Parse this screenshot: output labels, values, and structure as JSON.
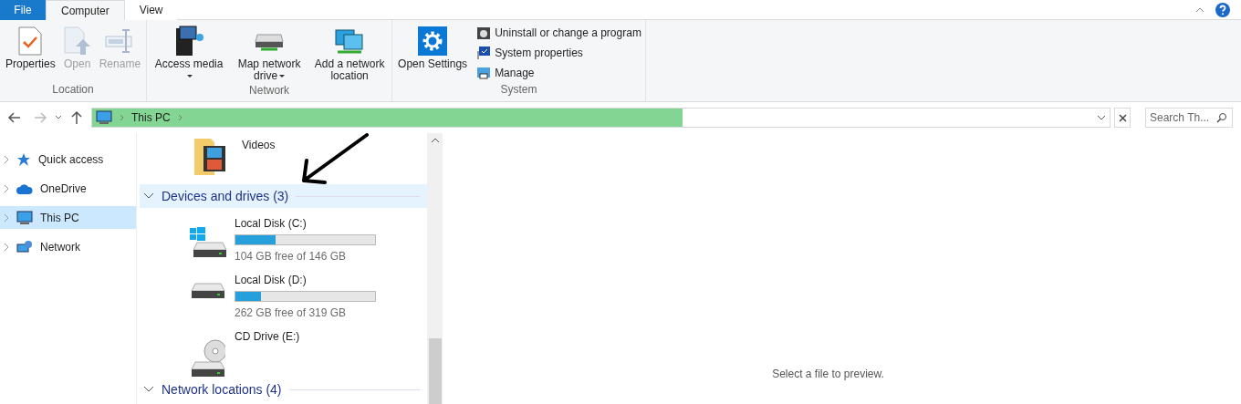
{
  "tabs": [
    {
      "label": "File",
      "kind": "file",
      "selected": false
    },
    {
      "label": "Computer",
      "kind": "tab",
      "selected": true
    },
    {
      "label": "View",
      "kind": "tab",
      "selected": false
    }
  ],
  "ribbon_groups": [
    {
      "label": "Location",
      "buttons": [
        {
          "label": "Properties",
          "disabled": false
        },
        {
          "label": "Open",
          "disabled": true
        },
        {
          "label": "Rename",
          "disabled": true
        }
      ]
    },
    {
      "label": "Network",
      "buttons": [
        {
          "label": "Access media",
          "disabled": false,
          "dropdown": true
        },
        {
          "label": "Map network drive",
          "disabled": false,
          "dropdown": true
        },
        {
          "label": "Add a network location",
          "disabled": false,
          "dropdown": false
        }
      ]
    },
    {
      "label": "System",
      "buttons": [
        {
          "label": "Open Settings",
          "disabled": false
        }
      ],
      "small_buttons": [
        {
          "label": "Uninstall or change a program"
        },
        {
          "label": "System properties"
        },
        {
          "label": "Manage"
        }
      ]
    }
  ],
  "address_bar": {
    "path": [
      "This PC"
    ],
    "level": 0.58
  },
  "search": {
    "placeholder": "Search Th..."
  },
  "nav_items": [
    {
      "label": "Quick access",
      "selected": false
    },
    {
      "label": "OneDrive",
      "selected": false
    },
    {
      "label": "This PC",
      "selected": true
    },
    {
      "label": "Network",
      "selected": false
    }
  ],
  "folder": {
    "label": "Videos"
  },
  "sections": [
    {
      "title": "Devices and drives (3)",
      "expanded": true,
      "selected": true,
      "drives": [
        {
          "name": "Local Disk (C:)",
          "level": 0.29,
          "free": "104 GB free of 146 GB"
        },
        {
          "name": "Local Disk (D:)",
          "level": 0.18,
          "free": "262 GB free of 319 GB"
        },
        {
          "name": "CD Drive (E:)"
        }
      ]
    },
    {
      "title": "Network locations (4)",
      "expanded": true,
      "selected": false
    }
  ],
  "preview": {
    "message": "Select a file to preview."
  }
}
